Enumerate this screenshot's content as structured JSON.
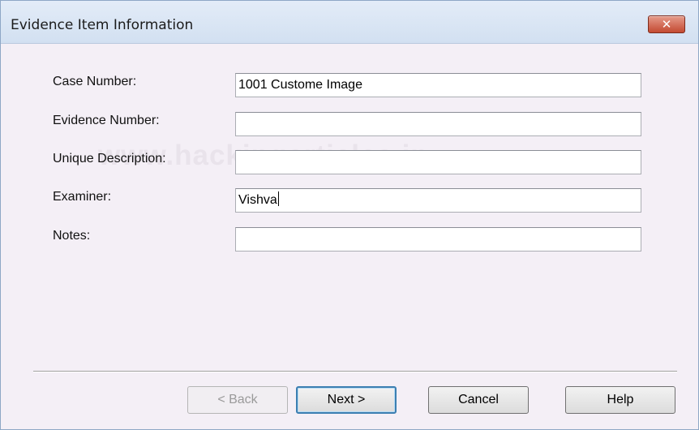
{
  "window": {
    "title": "Evidence Item Information",
    "close_icon": "close-icon"
  },
  "watermark": "www.hackingarticles.in",
  "form": {
    "case_number": {
      "label": "Case Number:",
      "value": "1001 Custome Image"
    },
    "evidence_number": {
      "label": "Evidence Number:",
      "value": ""
    },
    "unique_description": {
      "label": "Unique Description:",
      "value": ""
    },
    "examiner": {
      "label": "Examiner:",
      "value": "Vishva"
    },
    "notes": {
      "label": "Notes:",
      "value": ""
    }
  },
  "buttons": {
    "back": "< Back",
    "next": "Next >",
    "cancel": "Cancel",
    "help": "Help"
  },
  "colors": {
    "background": "#f4eff6",
    "titlebar": "#d2e0f1",
    "close_button": "#c34a31",
    "default_button_border": "#3c7fb1"
  }
}
